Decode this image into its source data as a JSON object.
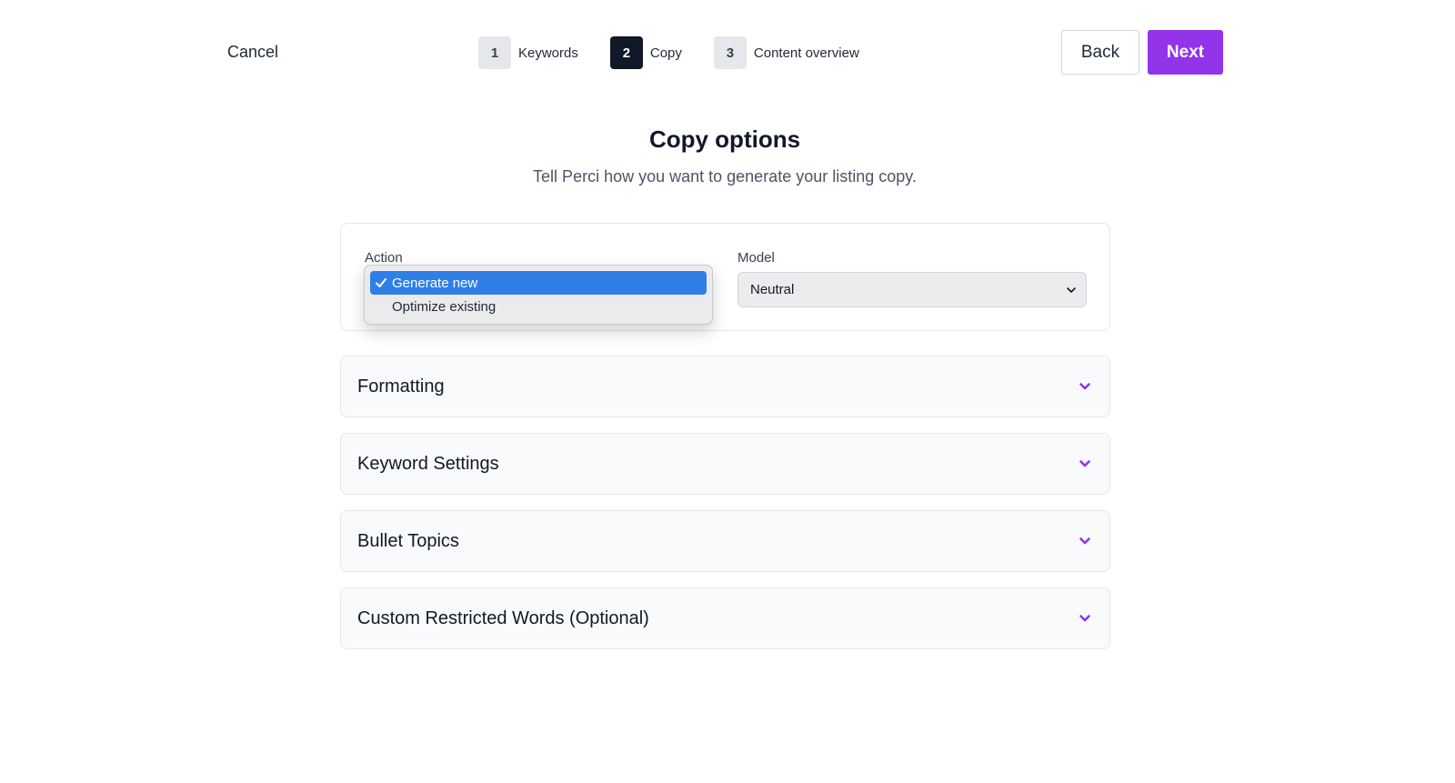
{
  "header": {
    "cancel_label": "Cancel",
    "steps": [
      {
        "num": "1",
        "label": "Keywords",
        "active": false
      },
      {
        "num": "2",
        "label": "Copy",
        "active": true
      },
      {
        "num": "3",
        "label": "Content overview",
        "active": false
      }
    ],
    "back_label": "Back",
    "next_label": "Next"
  },
  "page": {
    "title": "Copy options",
    "subtitle": "Tell Perci how you want to generate your listing copy."
  },
  "options": {
    "action_label": "Action",
    "action_options": [
      "Generate new",
      "Optimize existing"
    ],
    "action_selected": "Generate new",
    "model_label": "Model",
    "model_value": "Neutral"
  },
  "sections": [
    {
      "title": "Formatting"
    },
    {
      "title": "Keyword Settings"
    },
    {
      "title": "Bullet Topics"
    },
    {
      "title": "Custom Restricted Words (Optional)"
    }
  ],
  "colors": {
    "accent": "#9333ea",
    "active_step": "#111827",
    "dropdown_highlight": "#2f7fe6"
  },
  "icons": {
    "accordion": "chevron-down-icon",
    "select": "chevron-down-icon",
    "selected_option": "check-icon"
  }
}
